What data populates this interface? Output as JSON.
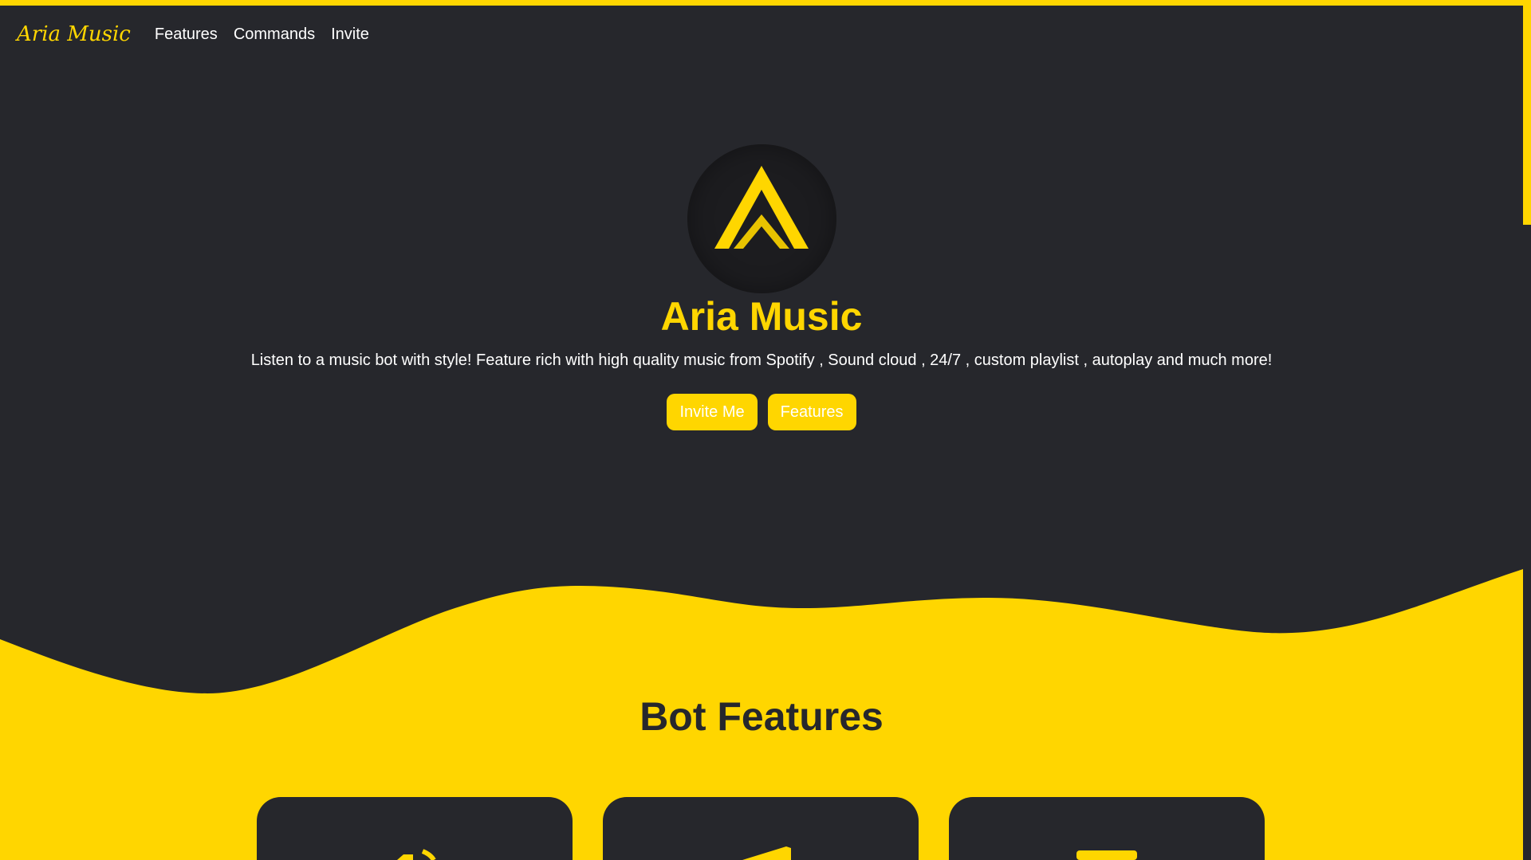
{
  "colors": {
    "accent": "#ffd600",
    "background": "#26272c",
    "text_light": "#ffffff",
    "logo_bg": "#1c1c1f"
  },
  "navbar": {
    "brand": "Aria Music",
    "links": [
      {
        "label": "Features"
      },
      {
        "label": "Commands"
      },
      {
        "label": "Invite"
      }
    ]
  },
  "hero": {
    "logo_icon": "aria-logo-icon",
    "title": "Aria Music",
    "subtitle": "Listen to a music bot with style! Feature rich with high quality music from Spotify , Sound cloud , 24/7 , custom playlist , autoplay and much more!",
    "buttons": {
      "invite_label": "Invite Me",
      "features_label": "Features"
    }
  },
  "features": {
    "title": "Bot Features",
    "cards": [
      {
        "icon": "volume-icon"
      },
      {
        "icon": "megaphone-icon"
      },
      {
        "icon": "playlist-icon"
      }
    ]
  }
}
